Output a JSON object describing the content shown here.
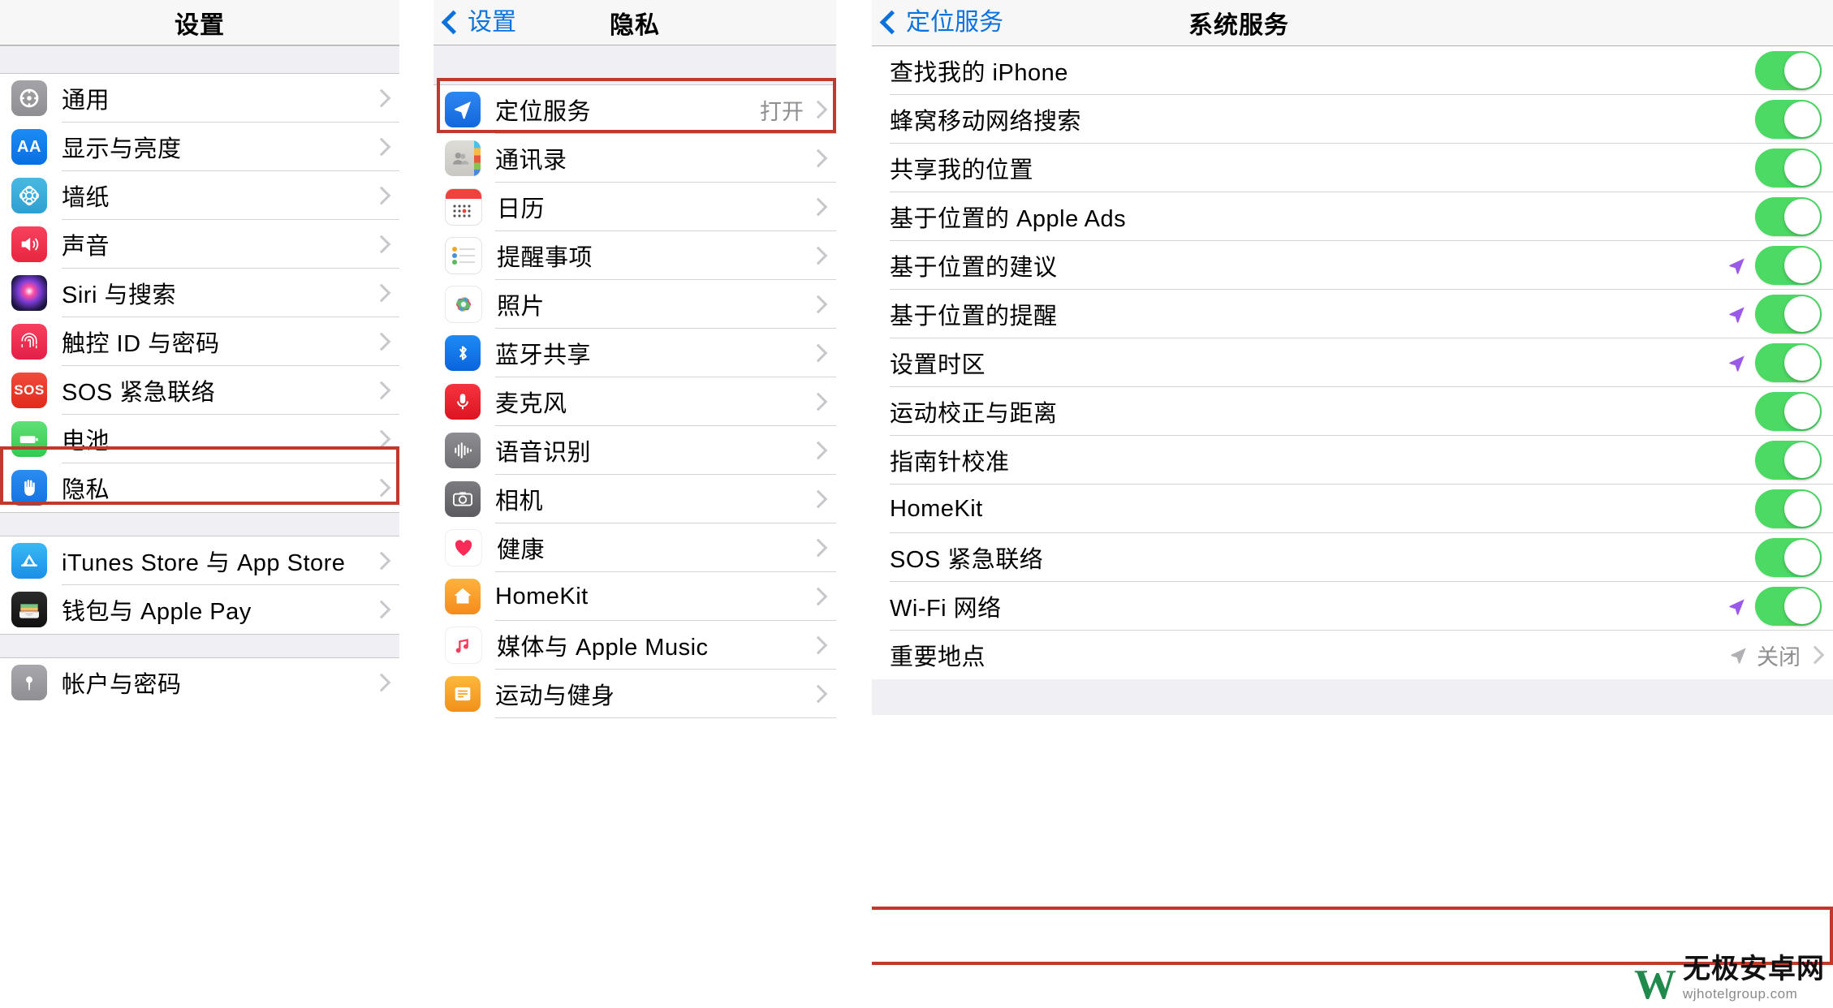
{
  "panels": {
    "settings": {
      "nav": {
        "title": "设置"
      },
      "groups": [
        {
          "items": [
            {
              "label": "通用",
              "icon": "gear-icon",
              "chevron": true
            },
            {
              "label": "显示与亮度",
              "icon": "display-brightness-icon",
              "chevron": true
            },
            {
              "label": "墙纸",
              "icon": "wallpaper-icon",
              "chevron": true
            },
            {
              "label": "声音",
              "icon": "sound-icon",
              "chevron": true
            },
            {
              "label": "Siri 与搜索",
              "icon": "siri-icon",
              "chevron": true
            },
            {
              "label": "触控 ID 与密码",
              "icon": "touch-id-icon",
              "chevron": true
            },
            {
              "label": "SOS 紧急联络",
              "icon": "sos-icon",
              "chevron": true
            },
            {
              "label": "电池",
              "icon": "battery-icon",
              "chevron": true
            },
            {
              "label": "隐私",
              "icon": "privacy-hand-icon",
              "chevron": true,
              "highlighted": true
            }
          ]
        },
        {
          "items": [
            {
              "label": "iTunes Store 与 App Store",
              "icon": "app-store-icon",
              "chevron": true
            },
            {
              "label": "钱包与 Apple Pay",
              "icon": "wallet-icon",
              "chevron": true
            }
          ]
        },
        {
          "items": [
            {
              "label": "帐户与密码",
              "icon": "accounts-passwords-icon",
              "chevron": true
            }
          ]
        }
      ]
    },
    "privacy": {
      "nav": {
        "back_label": "设置",
        "title": "隐私"
      },
      "items": [
        {
          "label": "定位服务",
          "icon": "location-services-icon",
          "value": "打开",
          "chevron": true,
          "highlighted": true
        },
        {
          "label": "通讯录",
          "icon": "contacts-icon",
          "value": "",
          "chevron": true
        },
        {
          "label": "日历",
          "icon": "calendar-icon",
          "value": "",
          "chevron": true
        },
        {
          "label": "提醒事项",
          "icon": "reminders-icon",
          "value": "",
          "chevron": true
        },
        {
          "label": "照片",
          "icon": "photos-icon",
          "value": "",
          "chevron": true
        },
        {
          "label": "蓝牙共享",
          "icon": "bluetooth-icon",
          "value": "",
          "chevron": true
        },
        {
          "label": "麦克风",
          "icon": "microphone-icon",
          "value": "",
          "chevron": true
        },
        {
          "label": "语音识别",
          "icon": "speech-recognition-icon",
          "value": "",
          "chevron": true
        },
        {
          "label": "相机",
          "icon": "camera-icon",
          "value": "",
          "chevron": true
        },
        {
          "label": "健康",
          "icon": "health-icon",
          "value": "",
          "chevron": true
        },
        {
          "label": "HomeKit",
          "icon": "homekit-icon",
          "value": "",
          "chevron": true
        },
        {
          "label": "媒体与 Apple Music",
          "icon": "apple-music-icon",
          "value": "",
          "chevron": true
        },
        {
          "label": "运动与健身",
          "icon": "fitness-icon",
          "value": "",
          "chevron": true
        }
      ]
    },
    "system_services": {
      "nav": {
        "back_label": "定位服务",
        "title": "系统服务"
      },
      "items": [
        {
          "label": "查找我的 iPhone",
          "toggle": true,
          "on": true,
          "arrow": false
        },
        {
          "label": "蜂窝移动网络搜索",
          "toggle": true,
          "on": true,
          "arrow": false
        },
        {
          "label": "共享我的位置",
          "toggle": true,
          "on": true,
          "arrow": false
        },
        {
          "label": "基于位置的 Apple Ads",
          "toggle": true,
          "on": true,
          "arrow": false
        },
        {
          "label": "基于位置的建议",
          "toggle": true,
          "on": true,
          "arrow": true
        },
        {
          "label": "基于位置的提醒",
          "toggle": true,
          "on": true,
          "arrow": true
        },
        {
          "label": "设置时区",
          "toggle": true,
          "on": true,
          "arrow": true
        },
        {
          "label": "运动校正与距离",
          "toggle": true,
          "on": true,
          "arrow": false
        },
        {
          "label": "指南针校准",
          "toggle": true,
          "on": true,
          "arrow": false
        },
        {
          "label": "HomeKit",
          "toggle": true,
          "on": true,
          "arrow": false
        },
        {
          "label": "SOS 紧急联络",
          "toggle": true,
          "on": true,
          "arrow": false
        },
        {
          "label": "Wi-Fi 网络",
          "toggle": true,
          "on": true,
          "arrow": true
        },
        {
          "label": "重要地点",
          "toggle": false,
          "value": "关闭",
          "chevron": true,
          "arrow": true,
          "highlighted": true
        }
      ]
    }
  },
  "watermark": {
    "logo_letter": "W",
    "title": "无极安卓网",
    "subtitle": "wjhotelgroup.com"
  },
  "colors": {
    "highlight_border": "#c0392b",
    "toggle_on": "#4cd964",
    "link_blue": "#0a72dd",
    "secondary_text": "#8e8e93",
    "group_bg": "#efeff4"
  }
}
